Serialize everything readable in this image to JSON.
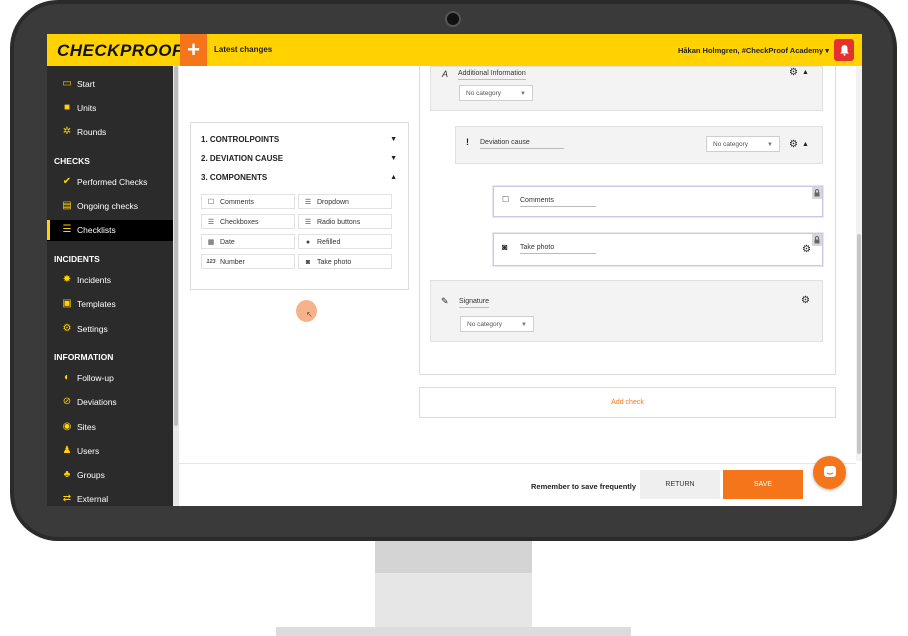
{
  "brand": {
    "logo": "CHECKPROOF",
    "accent": "#ffd200",
    "orange": "#f5761a"
  },
  "topbar": {
    "plus_label": "+",
    "latest_label": "Latest changes",
    "latest_caret": "▾",
    "user": "Håkan Holmgren, #CheckProof Academy ▾",
    "bell_icon": "bell-icon"
  },
  "sidebar": {
    "items_top": [
      {
        "label": "Start",
        "icon": "monitor-icon"
      },
      {
        "label": "Units",
        "icon": "truck-icon"
      },
      {
        "label": "Rounds",
        "icon": "rounds-icon"
      }
    ],
    "checks_head": "CHECKS",
    "checks": [
      {
        "label": "Performed Checks",
        "icon": "check-circle-icon"
      },
      {
        "label": "Ongoing checks",
        "icon": "clipboard-icon"
      },
      {
        "label": "Checklists",
        "icon": "list-icon",
        "active": true
      }
    ],
    "incidents_head": "INCIDENTS",
    "incidents": [
      {
        "label": "Incidents",
        "icon": "incident-icon"
      },
      {
        "label": "Templates",
        "icon": "template-icon"
      },
      {
        "label": "Settings",
        "icon": "settings-icon"
      }
    ],
    "information_head": "INFORMATION",
    "information": [
      {
        "label": "Follow-up",
        "icon": "follow-up-icon"
      },
      {
        "label": "Deviations",
        "icon": "alert-icon"
      },
      {
        "label": "Sites",
        "icon": "globe-icon"
      },
      {
        "label": "Users",
        "icon": "user-icon"
      },
      {
        "label": "Groups",
        "icon": "groups-icon"
      },
      {
        "label": "External",
        "icon": "handshake-icon"
      }
    ]
  },
  "accordion": {
    "rows": [
      "1. CONTROLPOINTS",
      "2. DEVIATION CAUSE",
      "3. COMPONENTS"
    ],
    "arrows": [
      "▼",
      "▼",
      "▲"
    ],
    "components": [
      {
        "label": "Comments",
        "icon": "comment-icon",
        "glyph": "☐"
      },
      {
        "label": "Dropdown",
        "icon": "dropdown-icon",
        "glyph": "☰"
      },
      {
        "label": "Checkboxes",
        "icon": "checkbox-list-icon",
        "glyph": "☰"
      },
      {
        "label": "Radio buttons",
        "icon": "radio-list-icon",
        "glyph": "☰"
      },
      {
        "label": "Date",
        "icon": "calendar-icon",
        "glyph": "▦"
      },
      {
        "label": "Refilled",
        "icon": "drop-icon",
        "glyph": "●"
      },
      {
        "label": "Number",
        "icon": "number-icon",
        "glyph": "123"
      },
      {
        "label": "Take photo",
        "icon": "camera-icon",
        "glyph": "◙"
      }
    ]
  },
  "form": {
    "additional": {
      "icon_glyph": "A",
      "label": "Additional Information",
      "select": "No category"
    },
    "deviation": {
      "icon_glyph": "!",
      "label": "Deviation cause",
      "select": "No category"
    },
    "comments": {
      "icon_glyph": "☐",
      "label": "Comments"
    },
    "photo": {
      "icon_glyph": "◙",
      "label": "Take photo"
    },
    "signature": {
      "icon_glyph": "✎",
      "label": "Signature",
      "select": "No category"
    },
    "gear": "⚙",
    "up": "▲",
    "lock": "🔒",
    "caret": "▼",
    "add_check": "Add check"
  },
  "footer": {
    "remember": "Remember to save frequently",
    "return": "RETURN",
    "save": "SAVE"
  },
  "chat_icon": "chat-icon"
}
